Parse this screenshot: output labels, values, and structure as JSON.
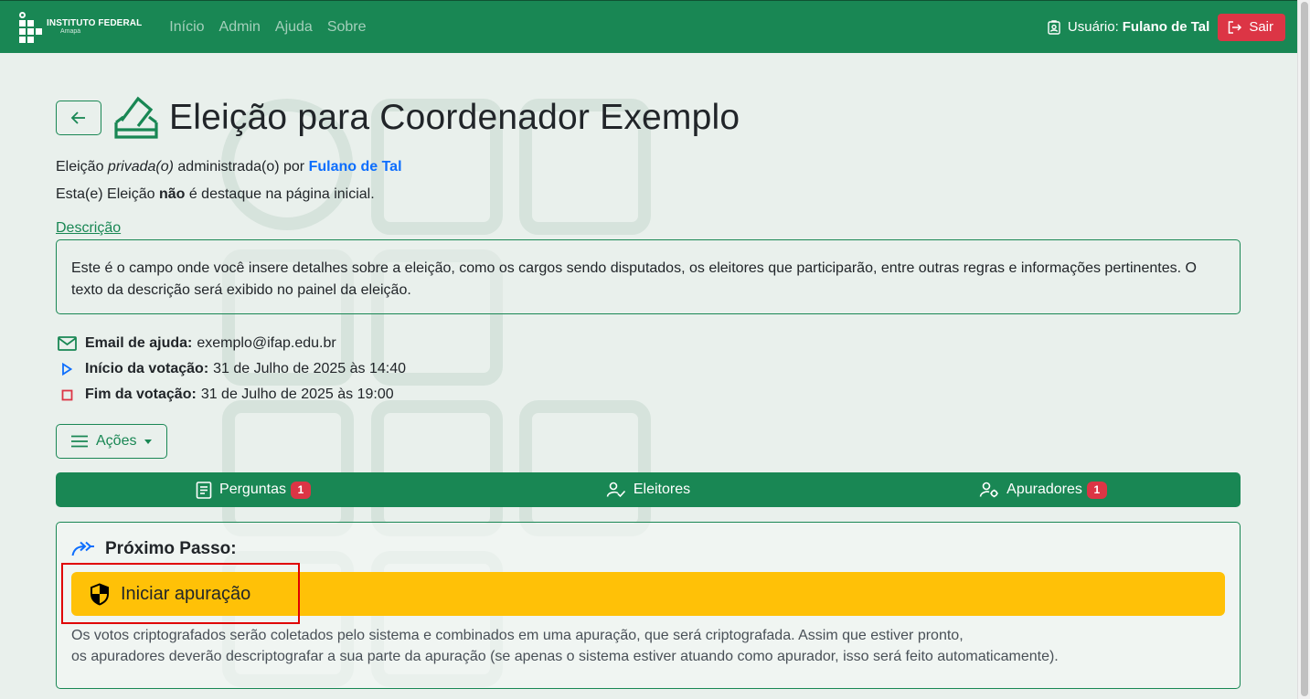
{
  "header": {
    "logo_line1": "INSTITUTO FEDERAL",
    "logo_line2": "Amapá",
    "nav": [
      "Início",
      "Admin",
      "Ajuda",
      "Sobre"
    ],
    "user_label": "Usuário:",
    "user_name": "Fulano de Tal",
    "logout_label": "Sair",
    "bg_color": "#198754"
  },
  "page": {
    "title": "Eleição para Coordenador Exemplo",
    "meta1_prefix": "Eleição ",
    "meta1_type": "privada(o)",
    "meta1_middle": " administrada(o) por ",
    "meta1_admin": "Fulano de Tal",
    "meta2_prefix": "Esta(e) Eleição ",
    "meta2_bold": "não",
    "meta2_suffix": " é destaque na página inicial.",
    "desc_link": "Descrição",
    "description": "Este é o campo onde você insere detalhes sobre a eleição, como os cargos sendo disputados, os eleitores que participarão, entre outras regras e informações pertinentes. O texto da descrição será exibido no painel da eleição."
  },
  "info": {
    "email_label": "Email de ajuda:",
    "email_value": "exemplo@ifap.edu.br",
    "start_label": "Início da votação:",
    "start_value": "31 de Julho de 2025 às 14:40",
    "end_label": "Fim da votação:",
    "end_value": "31 de Julho de 2025 às 19:00"
  },
  "actions": {
    "label": "Ações"
  },
  "tabs": [
    {
      "label": "Perguntas",
      "badge": "1"
    },
    {
      "label": "Eleitores"
    },
    {
      "label": "Apuradores",
      "badge": "1"
    }
  ],
  "next_step": {
    "heading": "Próximo Passo:",
    "button_label": "Iniciar apuração",
    "description_line1": "Os votos criptografados serão coletados pelo sistema e combinados em uma apuração, que será criptografada. Assim que estiver pronto,",
    "description_line2": "os apuradores deverão descriptografar a sua parte da apuração (se apenas o sistema estiver atuando como apurador, isso será feito automaticamente)."
  },
  "colors": {
    "primary": "#198754",
    "danger": "#dc3545",
    "warning": "#ffc107",
    "link": "#0d6efd"
  }
}
